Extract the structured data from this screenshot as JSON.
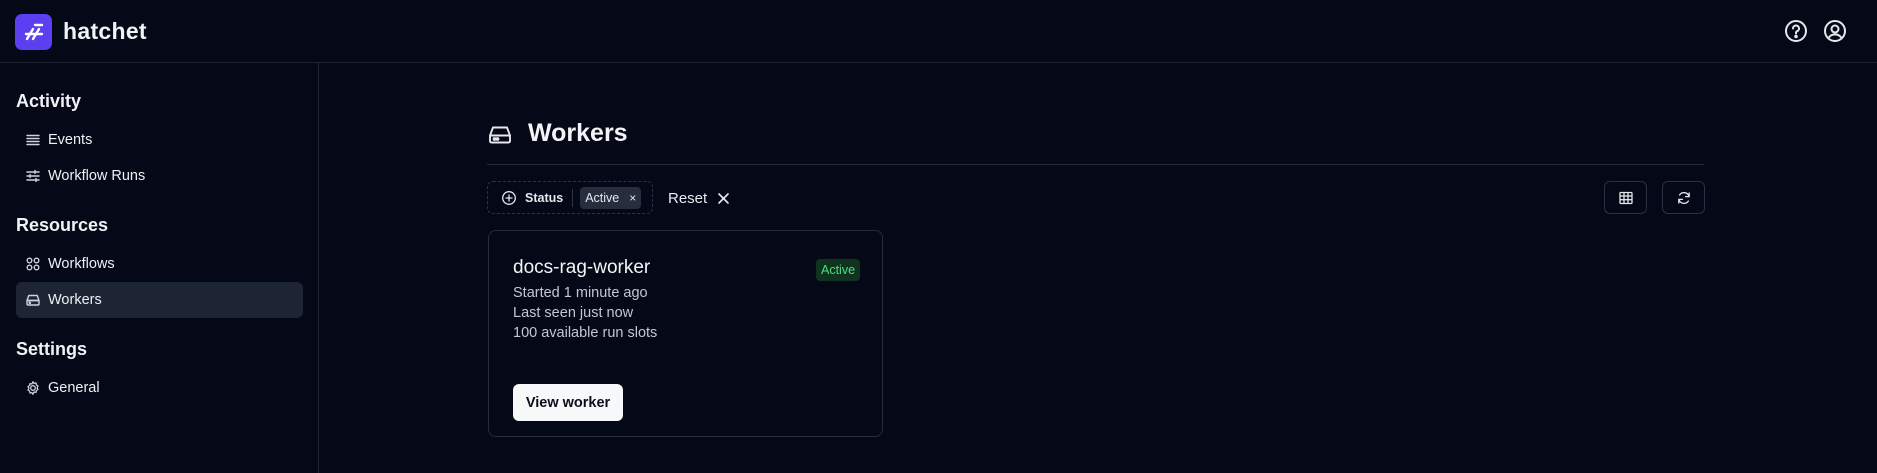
{
  "app": {
    "name": "hatchet"
  },
  "sidebar": {
    "sections": [
      {
        "title": "Activity",
        "items": [
          {
            "label": "Events",
            "icon": "list-icon"
          },
          {
            "label": "Workflow Runs",
            "icon": "sliders-icon"
          }
        ]
      },
      {
        "title": "Resources",
        "items": [
          {
            "label": "Workflows",
            "icon": "nodes-icon"
          },
          {
            "label": "Workers",
            "icon": "server-icon",
            "active": true
          }
        ]
      },
      {
        "title": "Settings",
        "items": [
          {
            "label": "General",
            "icon": "gear-icon"
          }
        ]
      }
    ]
  },
  "main": {
    "title": "Workers",
    "filter": {
      "label": "Status",
      "value": "Active",
      "remove": "×"
    },
    "reset_label": "Reset",
    "workers": [
      {
        "name": "docs-rag-worker",
        "status": "Active",
        "started": "Started 1 minute ago",
        "last_seen": "Last seen just now",
        "slots": "100 available run slots",
        "action": "View worker"
      }
    ]
  },
  "colors": {
    "background": "#050816",
    "brand": "#5b3ff0",
    "active_nav": "#1d2433",
    "status_active": "#4ade80"
  }
}
